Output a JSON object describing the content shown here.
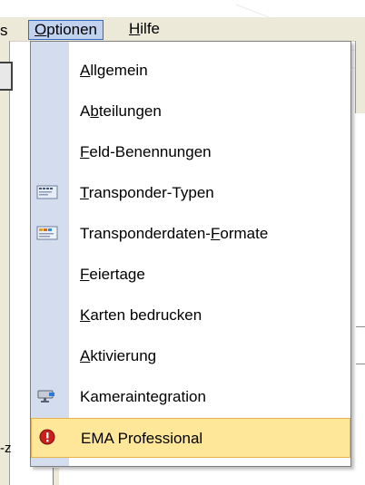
{
  "menubar": {
    "prev_fragment": "s",
    "items": [
      {
        "label_mnemonic": "O",
        "label_rest": "ptionen"
      },
      {
        "label_mnemonic": "H",
        "label_rest": "ilfe"
      }
    ]
  },
  "background": {
    "left_text": "-z"
  },
  "menu": {
    "items": [
      {
        "pre": "",
        "mnemonic": "A",
        "post": "llgemein",
        "icon": ""
      },
      {
        "pre": "A",
        "mnemonic": "b",
        "post": "teilungen",
        "icon": ""
      },
      {
        "pre": "",
        "mnemonic": "F",
        "post": "eld-Benennungen",
        "icon": ""
      },
      {
        "pre": "",
        "mnemonic": "T",
        "post": "ransponder-Typen",
        "icon": "transponder-card-icon"
      },
      {
        "pre": "Transponderdaten-",
        "mnemonic": "F",
        "post": "ormate",
        "icon": "transponder-format-icon"
      },
      {
        "pre": "",
        "mnemonic": "F",
        "post": "eiertage",
        "icon": ""
      },
      {
        "pre": "",
        "mnemonic": "K",
        "post": "arten bedrucken",
        "icon": ""
      },
      {
        "pre": "",
        "mnemonic": "A",
        "post": "ktivierung",
        "icon": ""
      },
      {
        "pre": "Kameraintegration",
        "mnemonic": "",
        "post": "",
        "icon": "camera-icon"
      },
      {
        "pre": "EMA Professional",
        "mnemonic": "",
        "post": "",
        "icon": "warning-icon"
      }
    ],
    "highlighted_index": 9
  },
  "colors": {
    "menubar_bg": "#ece9d8",
    "gutter": "#d4ddee",
    "highlight": "#ffe79a",
    "highlight_border": "#e5b24c",
    "warning_red": "#c8201a"
  }
}
